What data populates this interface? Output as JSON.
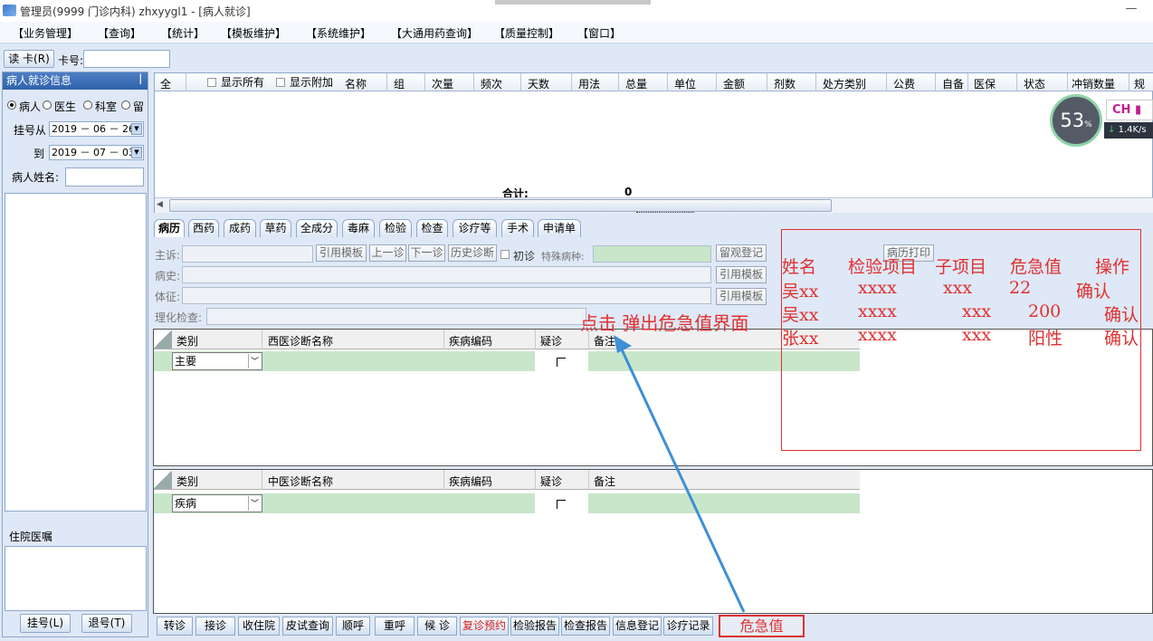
{
  "window": {
    "title": "管理员(9999 门诊内科) zhxyygl1 - [病人就诊]",
    "minimize": "—"
  },
  "menu": [
    "【业务管理】",
    "【查询】",
    "【统计】",
    "【模板维护】",
    "【系统维护】",
    "【大通用药查询】",
    "【质量控制】",
    "【窗口】"
  ],
  "cardbar": {
    "read_card": "读 卡(R)",
    "card_label": "卡号:"
  },
  "left": {
    "header": "病人就诊信息",
    "pin": "ꟾ",
    "radios": [
      "病人",
      "医生",
      "科室",
      "留"
    ],
    "from_label": "挂号从",
    "from_date": "2019 － 06 － 26",
    "to_label": "到",
    "to_date": "2019 － 07 － 03",
    "name_label": "病人姓名:",
    "inpatient_label": "住院医嘱",
    "register_btn": "挂号(L)",
    "unregister_btn": "退号(T)"
  },
  "rx_grid": {
    "first_col": "全",
    "show_all": "显示所有",
    "show_extra": "显示附加",
    "columns": [
      "名称",
      "组",
      "次量",
      "频次",
      "天数",
      "用法",
      "总量",
      "单位",
      "金额",
      "剂数",
      "处方类别",
      "公费",
      "自备",
      "医保",
      "状态",
      "冲销数量",
      "规"
    ],
    "total_label": "合计:",
    "total_value": "0"
  },
  "tabs": [
    "病历",
    "西药",
    "成药",
    "草药",
    "全成分",
    "毒麻",
    "检验",
    "检查",
    "诊疗等",
    "手术",
    "申请单"
  ],
  "record": {
    "complaint": "主诉:",
    "history": "病史:",
    "signs": "体征:",
    "lab": "理化检查:",
    "cite_template": "引用模板",
    "prev_visit": "上一诊",
    "next_visit": "下一诊",
    "history_diag": "历史诊断",
    "first_visit": "初诊",
    "special_disease": "特殊病种:",
    "observe": "留观登记",
    "print_record": "病历打印"
  },
  "western_table": {
    "columns": [
      "类别",
      "西医诊断名称",
      "疾病编码",
      "疑诊",
      "备注"
    ],
    "row_type": "主要"
  },
  "chinese_table": {
    "columns": [
      "类别",
      "中医诊断名称",
      "疾病编码",
      "疑诊",
      "备注"
    ],
    "row_type": "疾病"
  },
  "critical_popup": {
    "headers": [
      "姓名",
      "检验项目",
      "子项目",
      "危急值",
      "操作"
    ],
    "rows": [
      [
        "吴xx",
        "xxxx",
        "xxx",
        "22",
        "确认"
      ],
      [
        "吴xx",
        "xxxx",
        "xxx",
        "200",
        "确认"
      ],
      [
        "张xx",
        "xxxx",
        "xxx",
        "阳性",
        "确认"
      ]
    ]
  },
  "annotation": "点击 弹出危急值界面",
  "bottom_buttons": [
    "转诊",
    "接诊",
    "收住院",
    "皮试查询",
    "顺呼",
    "重呼",
    "候 诊",
    "复诊预约",
    "检验报告",
    "检查报告",
    "信息登记",
    "诊疗记录"
  ],
  "critical_button": "危急值",
  "net_widget": {
    "percent": "53",
    "percent_sign": "%",
    "ime": "CH",
    "speed": "1.4",
    "speed_unit": "K/s"
  },
  "colors": {
    "accent_red": "#e03030",
    "header_blue": "#2f62ab",
    "row_green": "#c8e6c9"
  }
}
